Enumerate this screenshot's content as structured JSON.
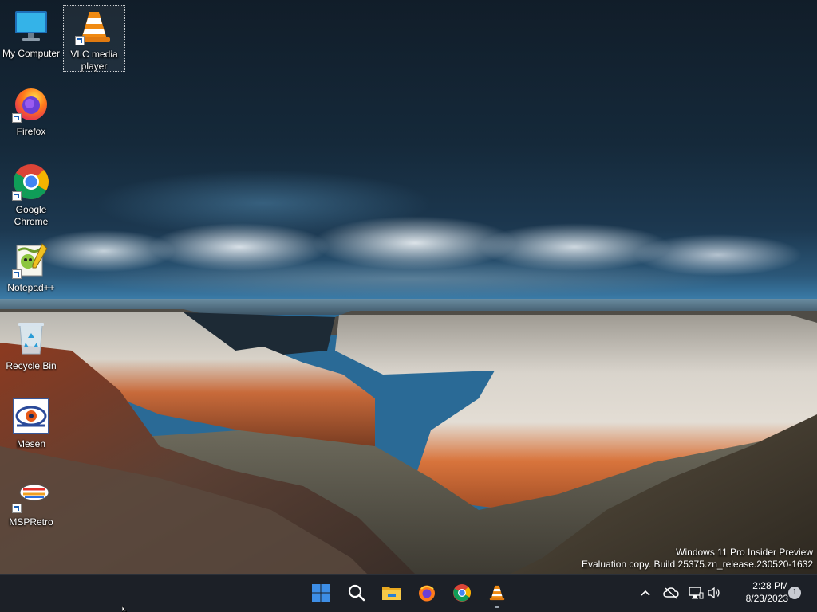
{
  "desktop": {
    "icons": [
      {
        "label": "My Computer"
      },
      {
        "label": "VLC media player"
      },
      {
        "label": "Firefox"
      },
      {
        "label": "Google Chrome"
      },
      {
        "label": "Notepad++"
      },
      {
        "label": "Recycle Bin"
      },
      {
        "label": "Mesen"
      },
      {
        "label": "MSPRetro"
      }
    ]
  },
  "watermark": {
    "line1": "Windows 11 Pro Insider Preview",
    "line2": "Evaluation copy. Build 25375.zn_release.230520-1632"
  },
  "taskbar": {
    "pinned": [
      "start-icon",
      "search-icon",
      "file-explorer-icon",
      "firefox-icon",
      "chrome-icon",
      "vlc-icon"
    ],
    "clock": {
      "time": "2:28 PM",
      "date": "8/23/2023"
    },
    "notification_count": "1",
    "colors": {
      "background": "#1c2027",
      "accent": "#3d8ee6"
    }
  }
}
